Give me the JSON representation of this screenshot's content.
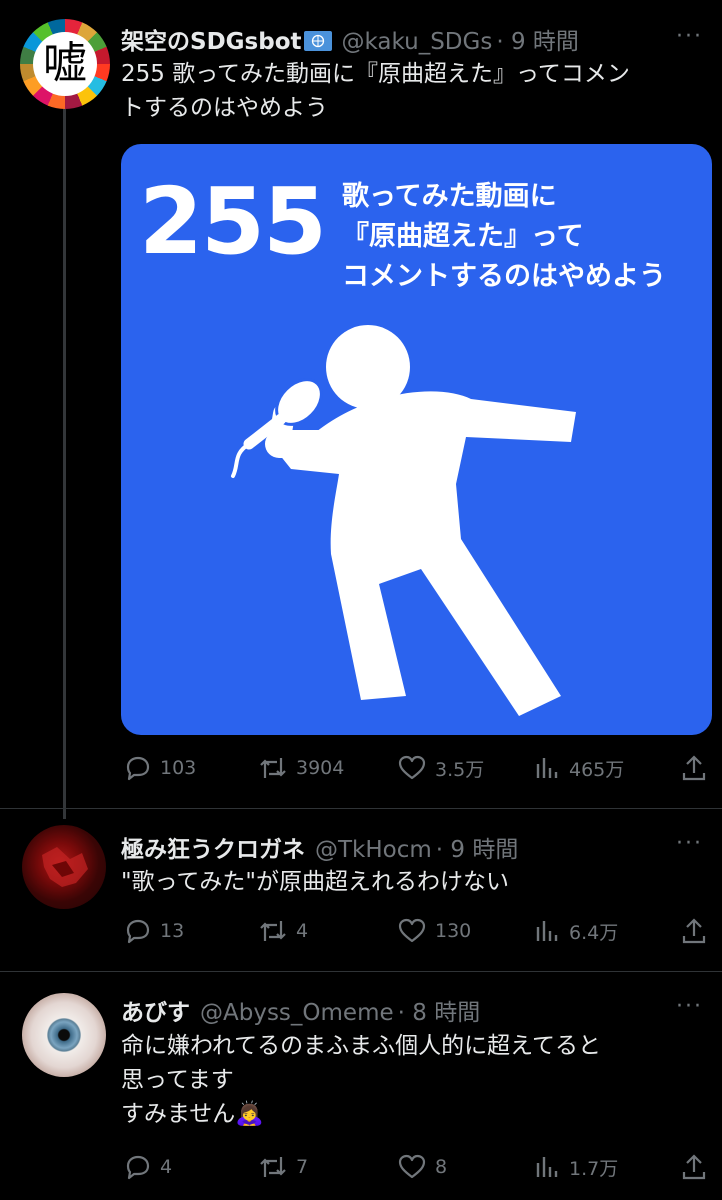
{
  "posts": [
    {
      "name": "架空のSDGsbot",
      "handle": "@kaku_SDGs",
      "time": "· 9 時間",
      "avatar_char": "嘘",
      "text_lines": [
        "255 歌ってみた動画に『原曲超えた』ってコメン",
        "トするのはやめよう"
      ],
      "media": {
        "number": "255",
        "title_lines": [
          "歌ってみた動画に",
          "『原曲超えた』って",
          "コメントするのはやめよう"
        ],
        "background": "#2b63ee",
        "pictogram": "singer-with-microphone"
      },
      "stats": {
        "replies": "103",
        "reposts": "3904",
        "likes": "3.5万",
        "views": "465万"
      }
    },
    {
      "name": "極み狂うクロガネ",
      "handle": "@TkHocm",
      "time": "· 9 時間",
      "text_lines": [
        "\"歌ってみた\"が原曲超えれるわけない"
      ],
      "stats": {
        "replies": "13",
        "reposts": "4",
        "likes": "130",
        "views": "6.4万"
      }
    },
    {
      "name": "あびす",
      "handle": "@Abyss_Omeme",
      "time": "· 8 時間",
      "text_lines": [
        "命に嫌われてるのまふまふ個人的に超えてると",
        "思ってます",
        "すみません"
      ],
      "emoji": "🙇‍♀️",
      "stats": {
        "replies": "4",
        "reposts": "7",
        "likes": "8",
        "views": "1.7万"
      }
    }
  ],
  "more_label": "···",
  "colors": {
    "background": "#000000",
    "text": "#e7e9ea",
    "muted": "#71767b",
    "accent": "#2b63ee"
  }
}
